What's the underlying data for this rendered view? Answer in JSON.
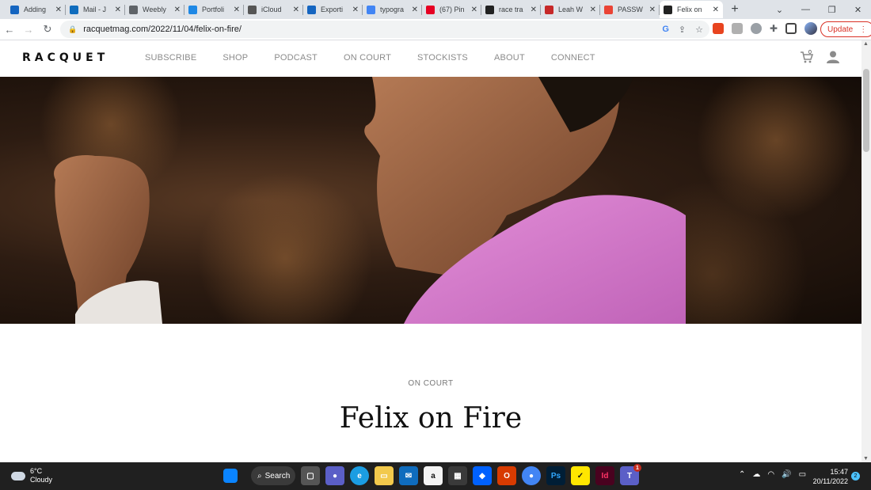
{
  "browser": {
    "tabs": [
      {
        "title": "Adding",
        "icon": "video-icon",
        "color": "#1565c0"
      },
      {
        "title": "Mail - J",
        "icon": "outlook-icon",
        "color": "#0f6cbd"
      },
      {
        "title": "Weebly",
        "icon": "globe-icon",
        "color": "#5f6368"
      },
      {
        "title": "Portfoli",
        "icon": "cloud-icon",
        "color": "#1e88e5"
      },
      {
        "title": "iCloud",
        "icon": "apple-icon",
        "color": "#555555"
      },
      {
        "title": "Exporti",
        "icon": "video-icon",
        "color": "#1565c0"
      },
      {
        "title": "typogra",
        "icon": "google-icon",
        "color": "#4285f4"
      },
      {
        "title": "(67) Pin",
        "icon": "pinterest-icon",
        "color": "#e60023"
      },
      {
        "title": "race tra",
        "icon": "strava-icon",
        "color": "#222222"
      },
      {
        "title": "Leah W",
        "icon": "shield-icon",
        "color": "#c62828"
      },
      {
        "title": "PASSW",
        "icon": "gmail-icon",
        "color": "#ea4335"
      },
      {
        "title": "Felix on",
        "icon": "pin-icon",
        "color": "#222222"
      }
    ],
    "active_tab": 11,
    "url": "racquetmag.com/2022/11/04/felix-on-fire/",
    "update_label": "Update"
  },
  "site": {
    "logo": "RACQUET",
    "nav": [
      "SUBSCRIBE",
      "SHOP",
      "PODCAST",
      "ON COURT",
      "STOCKISTS",
      "ABOUT",
      "CONNECT"
    ],
    "cart_count": "0"
  },
  "article": {
    "kicker": "ON COURT",
    "headline": "Felix on Fire"
  },
  "taskbar": {
    "temperature": "6°C",
    "condition": "Cloudy",
    "search_label": "Search",
    "time": "15:47",
    "date": "20/11/2022",
    "notifications": "2",
    "teams_badge": "1"
  }
}
